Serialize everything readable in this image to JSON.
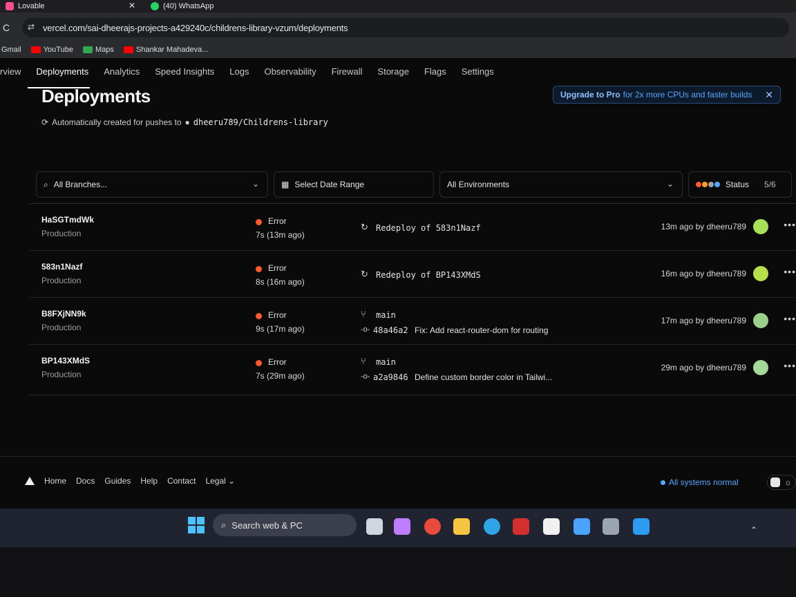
{
  "browser": {
    "tabs": [
      {
        "title": "Lovable",
        "color": "#ff4f8b"
      },
      {
        "title": "(40) WhatsApp",
        "color": "#25d366"
      }
    ],
    "url": "vercel.com/sai-dheerajs-projects-a429240c/childrens-library-vzum/deployments",
    "bookmarks": [
      {
        "label": "Gmail",
        "icon": "gmail-icon",
        "color": ""
      },
      {
        "label": "YouTube",
        "icon": "youtube-icon",
        "color": "#ff0000"
      },
      {
        "label": "Maps",
        "icon": "maps-icon",
        "color": "#34a853"
      },
      {
        "label": "Shankar Mahadeva...",
        "icon": "youtube-icon",
        "color": "#ff0000"
      }
    ]
  },
  "nav": {
    "tabs": [
      "rview",
      "Deployments",
      "Analytics",
      "Speed Insights",
      "Logs",
      "Observability",
      "Firewall",
      "Storage",
      "Flags",
      "Settings"
    ],
    "active": "Deployments"
  },
  "header": {
    "title": "Deployments",
    "subtitle": "Automatically created for pushes to",
    "repo": "dheeru789/Childrens-library",
    "upgrade_strong": "Upgrade to Pro",
    "upgrade_rest": "for 2x more CPUs and faster builds"
  },
  "filters": {
    "branches": "All Branches...",
    "date": "Select Date Range",
    "environments": "All Environments",
    "status_label": "Status",
    "status_count": "5/6",
    "status_colors": [
      "#ff5a2a",
      "#ff9d2a",
      "#a1a1a1",
      "#52a8ff"
    ]
  },
  "deployments": [
    {
      "id": "HaSGTmdWk",
      "env": "Production",
      "status": "Error",
      "duration": "7s (13m ago)",
      "source_type": "redeploy",
      "source_text": "Redeploy of 583n1Nazf",
      "commit_hash": "",
      "commit_msg": "",
      "when": "13m ago by dheeru789",
      "avatar": "#a8e05a"
    },
    {
      "id": "583n1Nazf",
      "env": "Production",
      "status": "Error",
      "duration": "8s (16m ago)",
      "source_type": "redeploy",
      "source_text": "Redeploy of BP143XMdS",
      "commit_hash": "",
      "commit_msg": "",
      "when": "16m ago by dheeru789",
      "avatar": "#b6e04a"
    },
    {
      "id": "B8FXjNN9k",
      "env": "Production",
      "status": "Error",
      "duration": "9s (17m ago)",
      "source_type": "branch",
      "source_text": "main",
      "commit_hash": "48a46a2",
      "commit_msg": "Fix: Add react-router-dom for routing",
      "when": "17m ago by dheeru789",
      "avatar": "#9bd08a"
    },
    {
      "id": "BP143XMdS",
      "env": "Production",
      "status": "Error",
      "duration": "7s (29m ago)",
      "source_type": "branch",
      "source_text": "main",
      "commit_hash": "a2a9846",
      "commit_msg": "Define custom border color in Tailwi...",
      "when": "29m ago by dheeru789",
      "avatar": "#a6d89a"
    }
  ],
  "footer": {
    "links": [
      "Home",
      "Docs",
      "Guides",
      "Help",
      "Contact",
      "Legal"
    ],
    "status": "All systems normal"
  },
  "taskbar": {
    "search_placeholder": "Search web & PC",
    "apps": [
      {
        "name": "task-view-icon",
        "color": "#cfd6e0"
      },
      {
        "name": "copilot-icon",
        "color": "#c07cff"
      },
      {
        "name": "chrome-icon",
        "color": "#e84b3c"
      },
      {
        "name": "file-explorer-icon",
        "color": "#f5c542"
      },
      {
        "name": "edge-icon",
        "color": "#2fa4e7"
      },
      {
        "name": "mcafee-icon",
        "color": "#d32f2f"
      },
      {
        "name": "store-icon",
        "color": "#f0f0f0"
      },
      {
        "name": "app-icon",
        "color": "#4aa3ff"
      },
      {
        "name": "remote-icon",
        "color": "#9aa5b1"
      },
      {
        "name": "vscode-icon",
        "color": "#2d9cf0"
      }
    ]
  }
}
